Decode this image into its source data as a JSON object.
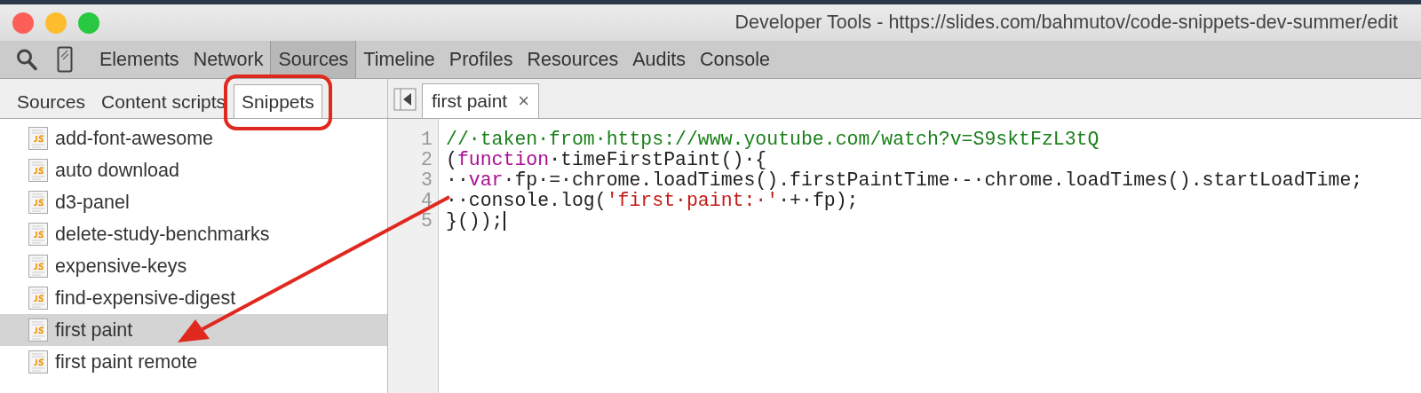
{
  "window": {
    "title": "Developer Tools - https://slides.com/bahmutov/code-snippets-dev-summer/edit"
  },
  "panel_tabs": [
    {
      "label": "Elements",
      "selected": false
    },
    {
      "label": "Network",
      "selected": false
    },
    {
      "label": "Sources",
      "selected": true
    },
    {
      "label": "Timeline",
      "selected": false
    },
    {
      "label": "Profiles",
      "selected": false
    },
    {
      "label": "Resources",
      "selected": false
    },
    {
      "label": "Audits",
      "selected": false
    },
    {
      "label": "Console",
      "selected": false
    }
  ],
  "navigator_tabs": [
    {
      "label": "Sources",
      "selected": false
    },
    {
      "label": "Content scripts",
      "selected": false
    },
    {
      "label": "Snippets",
      "selected": true
    }
  ],
  "editor_tabs": [
    {
      "label": "first paint",
      "close": "×",
      "selected": true
    }
  ],
  "snippets": [
    {
      "name": "add-font-awesome",
      "selected": false
    },
    {
      "name": "auto download",
      "selected": false
    },
    {
      "name": "d3-panel",
      "selected": false
    },
    {
      "name": "delete-study-benchmarks",
      "selected": false
    },
    {
      "name": "expensive-keys",
      "selected": false
    },
    {
      "name": "find-expensive-digest",
      "selected": false
    },
    {
      "name": "first paint",
      "selected": true
    },
    {
      "name": "first paint remote",
      "selected": false
    }
  ],
  "code": [
    {
      "number": "1",
      "tokens": [
        {
          "kind": "comment",
          "text": "//·taken·from·https://www.youtube.com/watch?v=S9sktFzL3tQ"
        }
      ]
    },
    {
      "number": "2",
      "tokens": [
        {
          "kind": "plain",
          "text": "("
        },
        {
          "kind": "keyword",
          "text": "function"
        },
        {
          "kind": "plain",
          "text": "·timeFirstPaint()·{"
        }
      ]
    },
    {
      "number": "3",
      "tokens": [
        {
          "kind": "plain",
          "text": "··"
        },
        {
          "kind": "keyword",
          "text": "var"
        },
        {
          "kind": "plain",
          "text": "·fp·=·chrome.loadTimes().firstPaintTime·-·chrome.loadTimes().startLoadTime;"
        }
      ]
    },
    {
      "number": "4",
      "tokens": [
        {
          "kind": "plain",
          "text": "··console.log("
        },
        {
          "kind": "string",
          "text": "'first·paint:·'"
        },
        {
          "kind": "plain",
          "text": "·+·fp);"
        }
      ]
    },
    {
      "number": "5",
      "tokens": [
        {
          "kind": "plain",
          "text": "}());"
        }
      ],
      "cursor": true
    }
  ]
}
